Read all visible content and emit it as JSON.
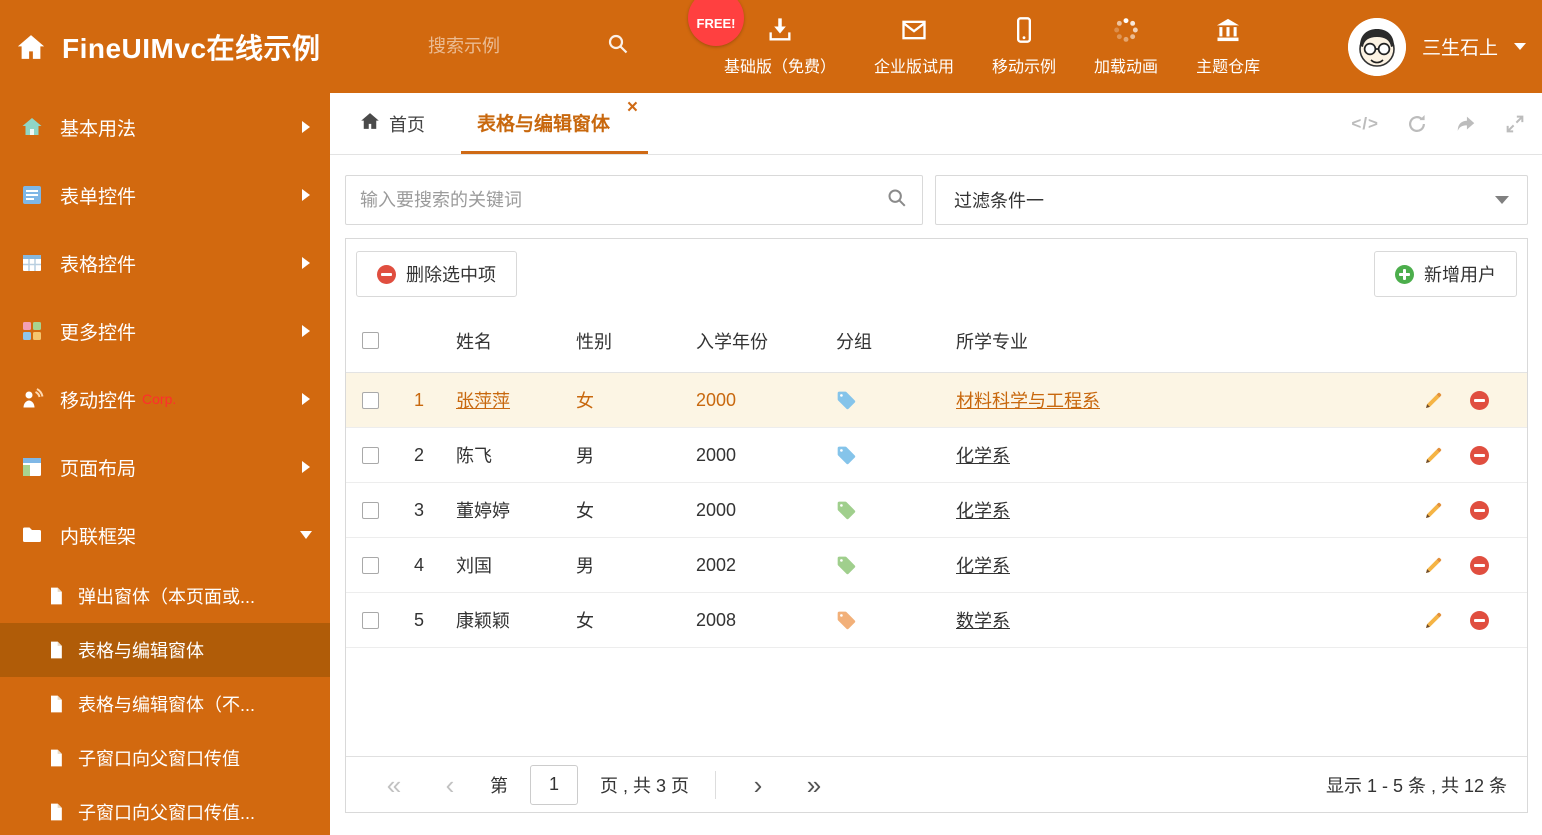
{
  "colors": {
    "primary": "#d2690f",
    "sidebar_active_bg": "#b05c08",
    "link_orange": "#c8680e",
    "row_highlight_bg": "#fcf5e4",
    "free_badge_bg": "#ff4040",
    "delete_red": "#e04e3f",
    "add_green": "#4cae4c"
  },
  "header": {
    "title": "FineUIMvc在线示例",
    "search_placeholder": "搜索示例",
    "free_badge": "FREE!",
    "nav_items": [
      {
        "label": "基础版（免费）",
        "icon": "download-icon"
      },
      {
        "label": "企业版试用",
        "icon": "envelope-icon"
      },
      {
        "label": "移动示例",
        "icon": "mobile-icon"
      },
      {
        "label": "加载动画",
        "icon": "spinner-icon"
      },
      {
        "label": "主题仓库",
        "icon": "bank-icon"
      }
    ],
    "user_name": "三生石上"
  },
  "sidebar": {
    "items": [
      {
        "label": "基本用法"
      },
      {
        "label": "表单控件"
      },
      {
        "label": "表格控件"
      },
      {
        "label": "更多控件"
      },
      {
        "label": "移动控件",
        "badge": "Corp."
      },
      {
        "label": "页面布局"
      },
      {
        "label": "内联框架"
      }
    ],
    "subitems": [
      {
        "label": "弹出窗体（本页面或..."
      },
      {
        "label": "表格与编辑窗体"
      },
      {
        "label": "表格与编辑窗体（不..."
      },
      {
        "label": "子窗口向父窗口传值"
      },
      {
        "label": "子窗口向父窗口传值..."
      }
    ]
  },
  "tabs": {
    "home": "首页",
    "active": "表格与编辑窗体",
    "close_glyph": "×"
  },
  "window_actions": {
    "code_glyph": "</>"
  },
  "filter": {
    "search_placeholder": "输入要搜索的关键词",
    "dropdown_value": "过滤条件一"
  },
  "toolbar": {
    "delete_label": "删除选中项",
    "add_label": "新增用户"
  },
  "table": {
    "columns": {
      "name": "姓名",
      "gender": "性别",
      "year": "入学年份",
      "group": "分组",
      "major": "所学专业"
    },
    "rows": [
      {
        "num": "1",
        "name": "张萍萍",
        "gender": "女",
        "year": "2000",
        "tag_color": "#85c4ea",
        "major": "材料科学与工程系"
      },
      {
        "num": "2",
        "name": "陈飞",
        "gender": "男",
        "year": "2000",
        "tag_color": "#85c4ea",
        "major": "化学系"
      },
      {
        "num": "3",
        "name": "董婷婷",
        "gender": "女",
        "year": "2000",
        "tag_color": "#a0cf8d",
        "major": "化学系"
      },
      {
        "num": "4",
        "name": "刘国",
        "gender": "男",
        "year": "2002",
        "tag_color": "#a0cf8d",
        "major": "化学系"
      },
      {
        "num": "5",
        "name": "康颖颖",
        "gender": "女",
        "year": "2008",
        "tag_color": "#f2b079",
        "major": "数学系"
      }
    ]
  },
  "pagination": {
    "first_glyph": "«",
    "prev_glyph": "‹",
    "next_glyph": "›",
    "last_glyph": "»",
    "prefix": "第",
    "current_page": "1",
    "suffix": "页 , 共 3 页",
    "summary": "显示 1 - 5 条 , 共 12 条"
  }
}
